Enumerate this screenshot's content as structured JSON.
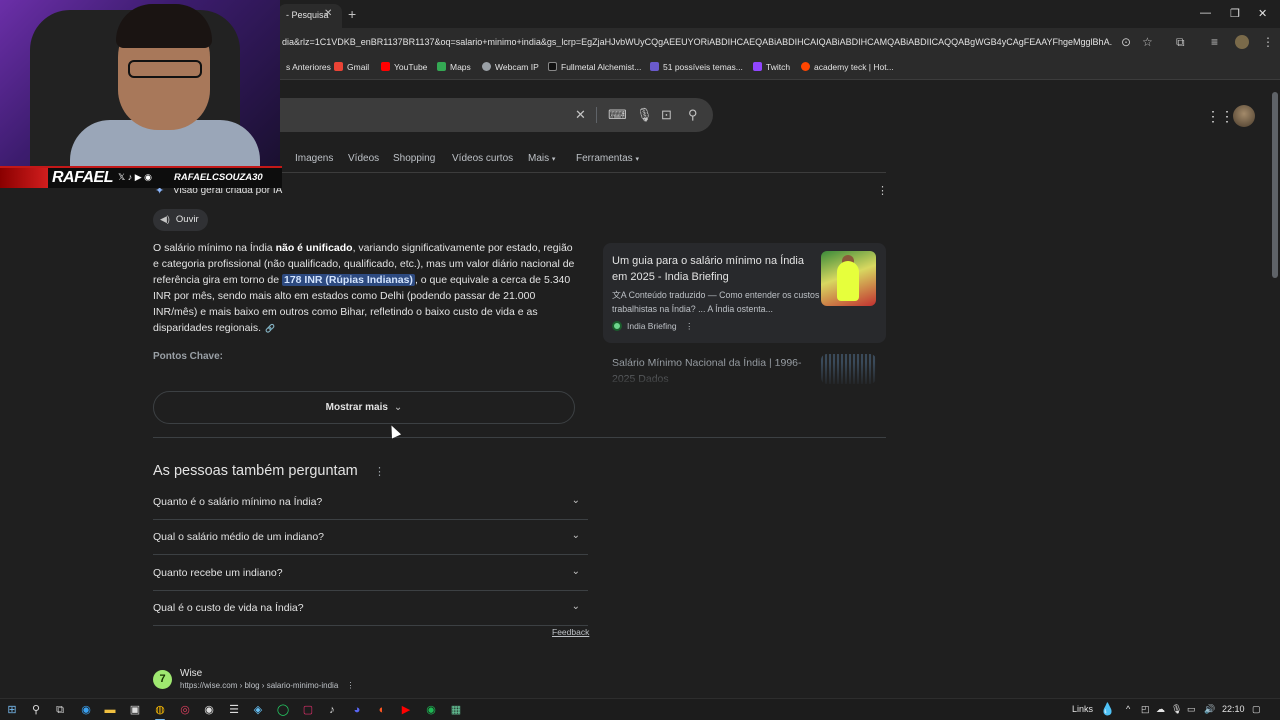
{
  "browser": {
    "tab_title": "- Pesquisa",
    "url": "dia&rlz=1C1VDKB_enBR1137BR1137&oq=salario+minimo+india&gs_lcrp=EgZjaHJvbWUyCQgAEEUYORiABDIHCAEQABiABDIHCAIQABiABDIHCAMQABiABDIICAQQABgWGB4yCAgFEAAYFhgeMgglBhA...",
    "bookmarks": [
      {
        "label": "s Anteriores",
        "color": "#8ab4f8"
      },
      {
        "label": "Gmail",
        "color": "#ea4335"
      },
      {
        "label": "YouTube",
        "color": "#ff0000"
      },
      {
        "label": "Maps",
        "color": "#34a853"
      },
      {
        "label": "Webcam IP",
        "color": "#9aa0a6"
      },
      {
        "label": "Fullmetal Alchemist...",
        "color": "#5f6368"
      },
      {
        "label": "51 possíveis temas...",
        "color": "#6a5acd"
      },
      {
        "label": "Twitch",
        "color": "#9146ff"
      },
      {
        "label": "academy teck | Hot...",
        "color": "#ff4500"
      }
    ]
  },
  "search": {
    "nav_tabs": [
      "Imagens",
      "Vídeos",
      "Shopping",
      "Vídeos curtos",
      "Mais",
      "Ferramentas"
    ]
  },
  "ai_overview": {
    "header": "Visão geral criada por IA",
    "listen_label": "Ouvir",
    "text": {
      "p1": "O salário mínimo na Índia ",
      "b1": "não é unificado",
      "p2": ", variando significativamente por estado, região e categoria profissional (não qualificado, qualificado, etc.), mas um valor diário nacional de referência gira em torno de ",
      "hl": "178 INR (Rúpias Indianas)",
      "p3": ", o que equivale a cerca de 5.340 INR por mês, sendo mais alto em estados como Delhi (podendo passar de 21.000 INR/mês) e mais baixo em outros como Bihar, refletindo o baixo custo de vida e as disparidades regionais."
    },
    "key_points": "Pontos Chave:",
    "show_more": "Mostrar mais",
    "source_card": {
      "title": "Um guia para o salário mínimo na Índia em 2025 - India Briefing",
      "desc": "Conteúdo traduzido — Como entender os custos trabalhistas na Índia? ... A Índia ostenta...",
      "source": "India Briefing"
    },
    "source_card2": {
      "title": "Salário Mínimo Nacional da Índia | 1996-2025 Dados"
    }
  },
  "people_also_ask": {
    "title": "As pessoas também perguntam",
    "questions": [
      "Quanto é o salário mínimo na Índia?",
      "Qual o salário médio de um indiano?",
      "Quanto recebe um indiano?",
      "Qual é o custo de vida na Índia?"
    ],
    "feedback": "Feedback"
  },
  "result": {
    "site": "Wise",
    "url": "https://wise.com › blog › salario-minimo-india"
  },
  "stream_overlay": {
    "name": "RAFAEL",
    "handle": "RAFAELCSOUZA30"
  },
  "taskbar": {
    "links_label": "Links",
    "time": "22:10"
  }
}
